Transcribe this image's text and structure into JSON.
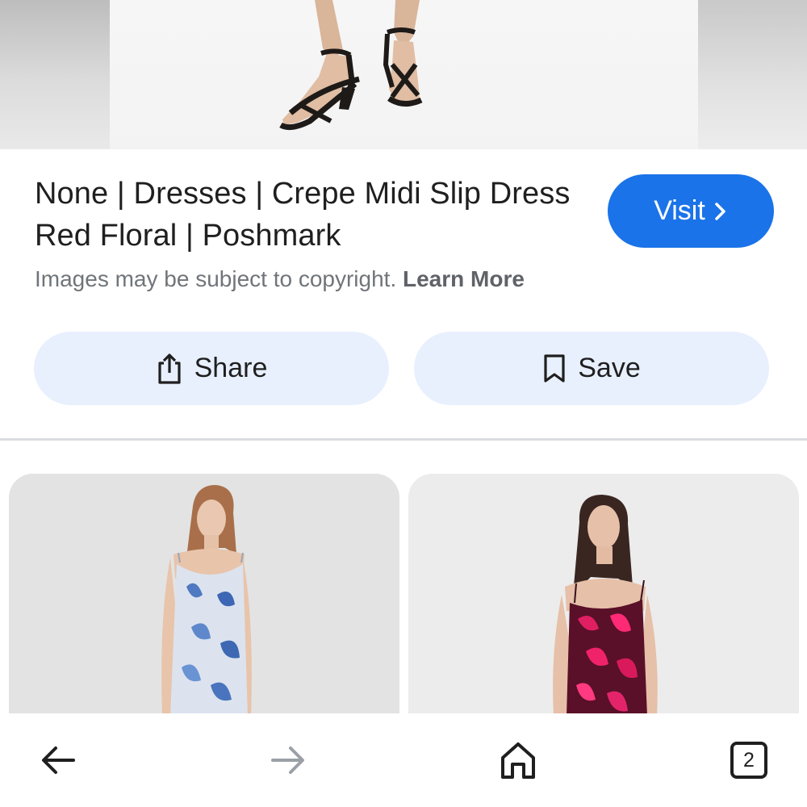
{
  "result": {
    "title": "None | Dresses | Crepe Midi Slip Dress Red Floral | Poshmark",
    "visit_label": "Visit"
  },
  "copyright": {
    "text": "Images may be subject to copyright.",
    "link_label": "Learn More"
  },
  "actions": {
    "share_label": "Share",
    "save_label": "Save"
  },
  "bottom_nav": {
    "tab_count": "2",
    "icons": [
      "back-arrow-icon",
      "forward-arrow-icon",
      "home-icon",
      "tabs-icon"
    ]
  },
  "colors": {
    "accent": "#1a73e8",
    "action_bg": "#e8f0fe",
    "muted_text": "#70757a"
  }
}
